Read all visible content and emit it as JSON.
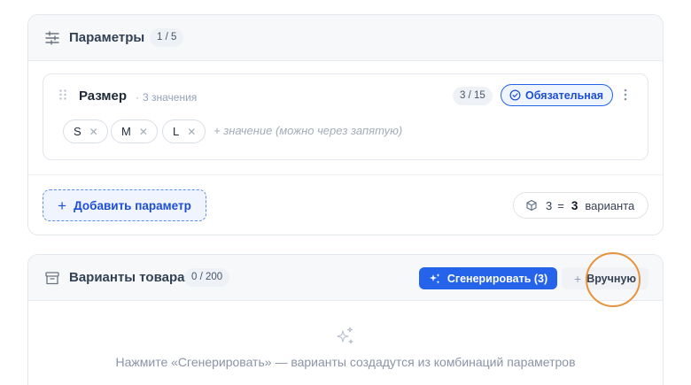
{
  "params_section": {
    "title": "Параметры",
    "count": "1 / 5",
    "icon": "sliders-icon"
  },
  "parameter": {
    "name": "Размер",
    "meta": "3 значения",
    "limit": "3 / 15",
    "required_label": "Обязательная",
    "values": [
      "S",
      "M",
      "L"
    ],
    "value_placeholder": "+ значение (можно через запятую)"
  },
  "params_footer": {
    "add_label": "Добавить параметр",
    "combo_count": "3",
    "combo_eq": "=",
    "combo_total": "3",
    "combo_word": "варианта"
  },
  "variants_section": {
    "title": "Варианты товара",
    "count": "0 / 200",
    "generate_label": "Сгенерировать (3)",
    "manual_label": "Вручную",
    "empty_text": "Нажмите «Сгенерировать» — варианты создадутся из комбинаций параметров"
  },
  "colors": {
    "accent": "#2563eb",
    "focus_ring": "#e8923a"
  }
}
